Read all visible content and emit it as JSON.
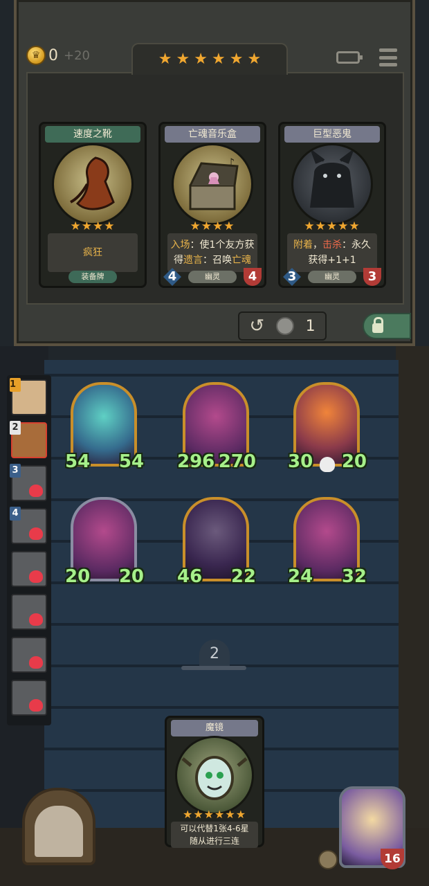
{
  "header": {
    "gold": "0",
    "gold_income": "+20",
    "tavern_stars": [
      "★",
      "★",
      "★",
      "★",
      "★",
      "★"
    ],
    "icons": {
      "coin": "crown-coin-icon",
      "battery": "battery-icon",
      "menu": "menu-icon"
    }
  },
  "shop": {
    "cards": [
      {
        "name": "速度之靴",
        "stars": "★★★★",
        "desc_lines": [
          "疯狂"
        ],
        "tag": "装备牌",
        "attack": null,
        "health": null,
        "style": "green"
      },
      {
        "name": "亡魂音乐盒",
        "stars": "★★★★",
        "desc_parts": [
          {
            "t": "入场",
            "c": "hl"
          },
          {
            "t": "：使1个友方获",
            "c": ""
          },
          {
            "t": "得",
            "c": ""
          },
          {
            "t": "遗言",
            "c": "hl"
          },
          {
            "t": "：召唤",
            "c": ""
          },
          {
            "t": "亡魂",
            "c": "hl"
          }
        ],
        "tag": "幽灵",
        "attack": "4",
        "health": "4",
        "style": "gray"
      },
      {
        "name": "巨型恶鬼",
        "stars": "★★★★★",
        "desc_parts": [
          {
            "t": "附着",
            "c": "hl"
          },
          {
            "t": "，",
            "c": ""
          },
          {
            "t": "击杀",
            "c": "hlr"
          },
          {
            "t": "：永久",
            "c": ""
          },
          {
            "t": "获得+1+1",
            "c": ""
          }
        ],
        "tag": "幽灵",
        "attack": "3",
        "health": "3",
        "style": "gray"
      }
    ],
    "refresh": {
      "cost": "1",
      "icon": "refresh-icon"
    },
    "freeze": {
      "icon": "lock-icon"
    }
  },
  "players": [
    {
      "rank": "1",
      "rank_style": "gold",
      "dead": false
    },
    {
      "rank": "2",
      "rank_style": "white",
      "dead": false,
      "active": true
    },
    {
      "rank": "3",
      "rank_style": "",
      "dead": true
    },
    {
      "rank": "4",
      "rank_style": "",
      "dead": true
    },
    {
      "rank": "",
      "rank_style": "",
      "dead": true
    },
    {
      "rank": "",
      "rank_style": "",
      "dead": true
    },
    {
      "rank": "",
      "rank_style": "",
      "dead": true
    },
    {
      "rank": "",
      "rank_style": "",
      "dead": true
    }
  ],
  "board": {
    "minions": [
      {
        "name": "ghost-minion",
        "attack": "54",
        "health": "54",
        "frame": "gold",
        "art": "teal"
      },
      {
        "name": "dragon-minion",
        "attack": "296",
        "health": "270",
        "frame": "gold",
        "art": "purple"
      },
      {
        "name": "fire-boar-minion",
        "attack": "30",
        "health": "20",
        "frame": "gold",
        "art": "fire",
        "skull": true
      },
      {
        "name": "clown-minion",
        "attack": "20",
        "health": "20",
        "frame": "silver",
        "art": "purple"
      },
      {
        "name": "plague-doctor-minion",
        "attack": "46",
        "health": "22",
        "frame": "gold",
        "art": "dark"
      },
      {
        "name": "horned-beast-minion",
        "attack": "24",
        "health": "32",
        "frame": "gold",
        "art": "purple"
      }
    ],
    "page": "2"
  },
  "hand": {
    "card": {
      "name": "魔镜",
      "stars": "★★★★★★",
      "desc_lines": [
        "可以代替1张4-6星",
        "随从进行三连"
      ]
    }
  },
  "hero": {
    "health": "16"
  }
}
